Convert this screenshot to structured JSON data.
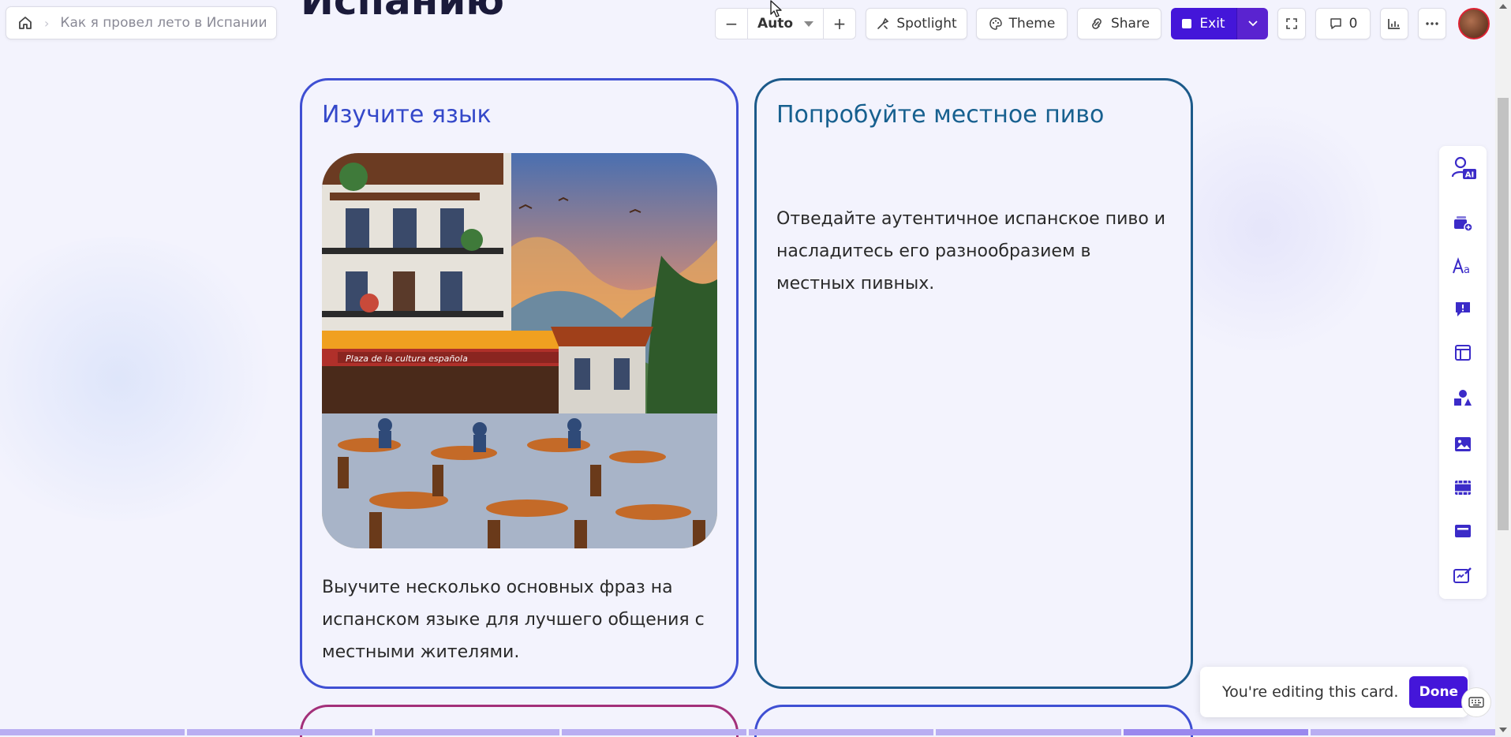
{
  "breadcrumb": {
    "current": "Как я провел лето в Испании"
  },
  "page_title": "Испанию",
  "toolbar": {
    "zoom_minus": "−",
    "zoom_value": "Auto",
    "zoom_plus": "+",
    "spotlight": "Spotlight",
    "theme": "Theme",
    "share": "Share",
    "exit": "Exit",
    "comments_count": "0"
  },
  "cards": [
    {
      "title": "Изучите язык",
      "text": "Выучите несколько основных фраз на испанском языке для лучшего общения с местными жителями.",
      "image_sign": "Plaza de la cultura española"
    },
    {
      "title": "Попробуйте местное пиво",
      "text": "Отведайте аутентичное испанское пиво и насладитесь его разнообразием в местных пивных."
    }
  ],
  "rail": {
    "ai_badge": "AI",
    "items": [
      "ai-assistant-icon",
      "add-card-icon",
      "text-style-icon",
      "callout-icon",
      "layout-icon",
      "shapes-icon",
      "image-icon",
      "video-icon",
      "embed-icon",
      "form-icon"
    ]
  },
  "toast": {
    "message": "You're editing this card.",
    "done": "Done"
  },
  "colors": {
    "accent": "#4416d9",
    "card_left_border": "#3f4fd3",
    "card_right_border": "#1c5a8a",
    "background": "#f3f3fd"
  }
}
